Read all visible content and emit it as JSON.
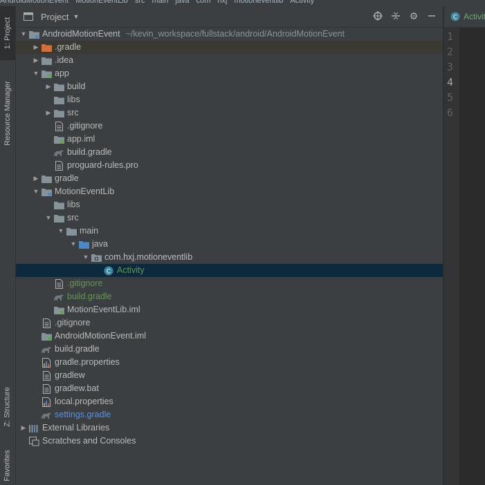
{
  "breadcrumb": [
    "AndroidMotionEvent",
    "MotionEventLib",
    "src",
    "main",
    "java",
    "com",
    "hxj",
    "motioneventlib",
    "Activity"
  ],
  "stripe": {
    "project_tab": "1: Project",
    "resource_tab": "Resource Manager",
    "structure_tab": "Z: Structure",
    "favorites_tab": "Favorites"
  },
  "panel": {
    "title": "Project",
    "icons": [
      "locate-icon",
      "collapse-icon",
      "gear-icon",
      "minimize-icon"
    ]
  },
  "tree": [
    {
      "indent": 0,
      "arrow": "down",
      "icon": "module-folder",
      "label": "AndroidMotionEvent",
      "path": "~/kevin_workspace/fullstack/android/AndroidMotionEvent",
      "name": "tree-root-androidmotionevent"
    },
    {
      "indent": 1,
      "arrow": "right",
      "icon": "folder-orange",
      "label": ".gradle",
      "name": "tree-item-dot-gradle",
      "hl": true
    },
    {
      "indent": 1,
      "arrow": "right",
      "icon": "folder",
      "label": ".idea",
      "name": "tree-item-idea"
    },
    {
      "indent": 1,
      "arrow": "down",
      "icon": "module-folder-green",
      "label": "app",
      "name": "tree-item-app"
    },
    {
      "indent": 2,
      "arrow": "right",
      "icon": "folder",
      "label": "build",
      "name": "tree-item-build"
    },
    {
      "indent": 2,
      "arrow": "",
      "icon": "folder",
      "label": "libs",
      "name": "tree-item-libs"
    },
    {
      "indent": 2,
      "arrow": "right",
      "icon": "folder",
      "label": "src",
      "name": "tree-item-src"
    },
    {
      "indent": 2,
      "arrow": "",
      "icon": "file",
      "label": ".gitignore",
      "name": "tree-item-gitignore"
    },
    {
      "indent": 2,
      "arrow": "",
      "icon": "iml",
      "label": "app.iml",
      "name": "tree-item-app-iml"
    },
    {
      "indent": 2,
      "arrow": "",
      "icon": "gradle",
      "label": "build.gradle",
      "name": "tree-item-build-gradle"
    },
    {
      "indent": 2,
      "arrow": "",
      "icon": "file",
      "label": "proguard-rules.pro",
      "name": "tree-item-proguard"
    },
    {
      "indent": 1,
      "arrow": "right",
      "icon": "folder",
      "label": "gradle",
      "name": "tree-item-gradle"
    },
    {
      "indent": 1,
      "arrow": "down",
      "icon": "module-folder",
      "label": "MotionEventLib",
      "name": "tree-item-motioneventlib"
    },
    {
      "indent": 2,
      "arrow": "",
      "icon": "folder",
      "label": "libs",
      "name": "tree-item-lib-libs"
    },
    {
      "indent": 2,
      "arrow": "down",
      "icon": "folder",
      "label": "src",
      "name": "tree-item-lib-src"
    },
    {
      "indent": 3,
      "arrow": "down",
      "icon": "folder",
      "label": "main",
      "name": "tree-item-main"
    },
    {
      "indent": 4,
      "arrow": "down",
      "icon": "folder-blue",
      "label": "java",
      "name": "tree-item-java"
    },
    {
      "indent": 5,
      "arrow": "down",
      "icon": "package",
      "label": "com.hxj.motioneventlib",
      "name": "tree-item-package"
    },
    {
      "indent": 6,
      "arrow": "",
      "icon": "class",
      "label": "Activity",
      "name": "tree-item-activity",
      "sel": true,
      "color": "green"
    },
    {
      "indent": 2,
      "arrow": "",
      "icon": "file",
      "label": ".gitignore",
      "name": "tree-item-lib-gitignore",
      "color": "green"
    },
    {
      "indent": 2,
      "arrow": "",
      "icon": "gradle",
      "label": "build.gradle",
      "name": "tree-item-lib-build-gradle",
      "color": "green"
    },
    {
      "indent": 2,
      "arrow": "",
      "icon": "iml",
      "label": "MotionEventLib.iml",
      "name": "tree-item-lib-iml"
    },
    {
      "indent": 1,
      "arrow": "",
      "icon": "file",
      "label": ".gitignore",
      "name": "tree-item-root-gitignore"
    },
    {
      "indent": 1,
      "arrow": "",
      "icon": "iml",
      "label": "AndroidMotionEvent.iml",
      "name": "tree-item-root-iml"
    },
    {
      "indent": 1,
      "arrow": "",
      "icon": "gradle",
      "label": "build.gradle",
      "name": "tree-item-root-build-gradle"
    },
    {
      "indent": 1,
      "arrow": "",
      "icon": "properties",
      "label": "gradle.properties",
      "name": "tree-item-gradle-properties"
    },
    {
      "indent": 1,
      "arrow": "",
      "icon": "file",
      "label": "gradlew",
      "name": "tree-item-gradlew"
    },
    {
      "indent": 1,
      "arrow": "",
      "icon": "file",
      "label": "gradlew.bat",
      "name": "tree-item-gradlew-bat"
    },
    {
      "indent": 1,
      "arrow": "",
      "icon": "properties",
      "label": "local.properties",
      "name": "tree-item-local-properties"
    },
    {
      "indent": 1,
      "arrow": "",
      "icon": "gradle",
      "label": "settings.gradle",
      "name": "tree-item-settings-gradle",
      "color": "blue"
    },
    {
      "indent": 0,
      "arrow": "right",
      "icon": "libraries",
      "label": "External Libraries",
      "name": "tree-item-external-libraries"
    },
    {
      "indent": 0,
      "arrow": "",
      "icon": "scratches",
      "label": "Scratches and Consoles",
      "name": "tree-item-scratches"
    }
  ],
  "editor": {
    "tab_label": "Activit",
    "line_numbers": [
      "1",
      "2",
      "3",
      "4",
      "5",
      "6"
    ],
    "current_line": "4"
  },
  "colors": {
    "selection": "#0d293e",
    "panel_bg": "#3c3f41",
    "editor_bg": "#2b2b2b",
    "git_added": "#629755",
    "git_modified": "#5394ec"
  }
}
